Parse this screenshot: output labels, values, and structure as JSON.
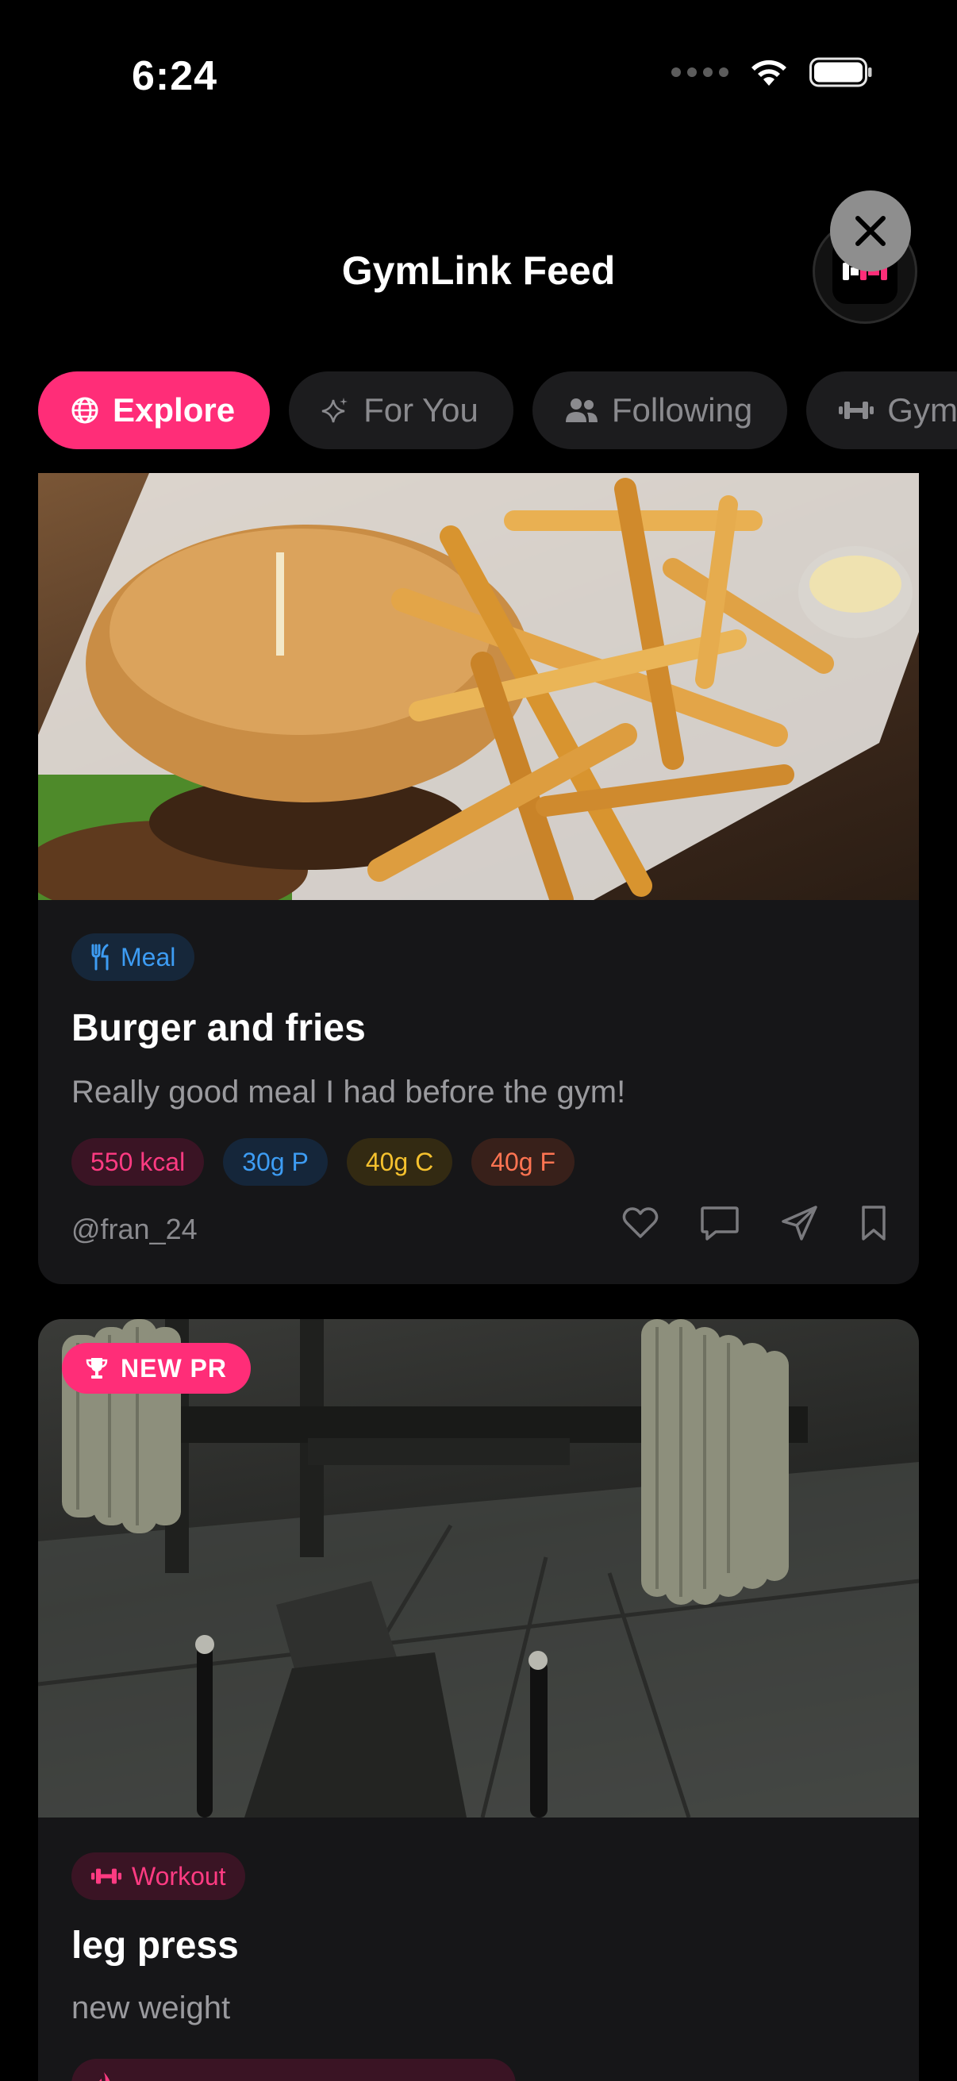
{
  "status_bar": {
    "time": "6:24"
  },
  "header": {
    "title": "GymLink Feed"
  },
  "tabs": [
    {
      "label": "Explore",
      "icon": "globe-icon",
      "active": true
    },
    {
      "label": "For You",
      "icon": "sparkle-icon",
      "active": false
    },
    {
      "label": "Following",
      "icon": "people-icon",
      "active": false
    },
    {
      "label": "Gym",
      "icon": "dumbbell-icon",
      "active": false
    }
  ],
  "posts": [
    {
      "category": "Meal",
      "category_icon": "fork-knife-icon",
      "title": "Burger and fries",
      "description": "Really good meal I had before the gym!",
      "macros": {
        "kcal": "550 kcal",
        "protein": "30g P",
        "carbs": "40g C",
        "fat": "40g F"
      },
      "username": "@fran_24"
    },
    {
      "badge": "NEW PR",
      "category": "Workout",
      "category_icon": "dumbbell-icon",
      "title": "leg press",
      "description": "new weight"
    }
  ],
  "colors": {
    "accent": "#ff2d78",
    "meal": "#3d9cf3",
    "carbs": "#f5c12e",
    "fat": "#ff7452",
    "card": "#161618"
  }
}
